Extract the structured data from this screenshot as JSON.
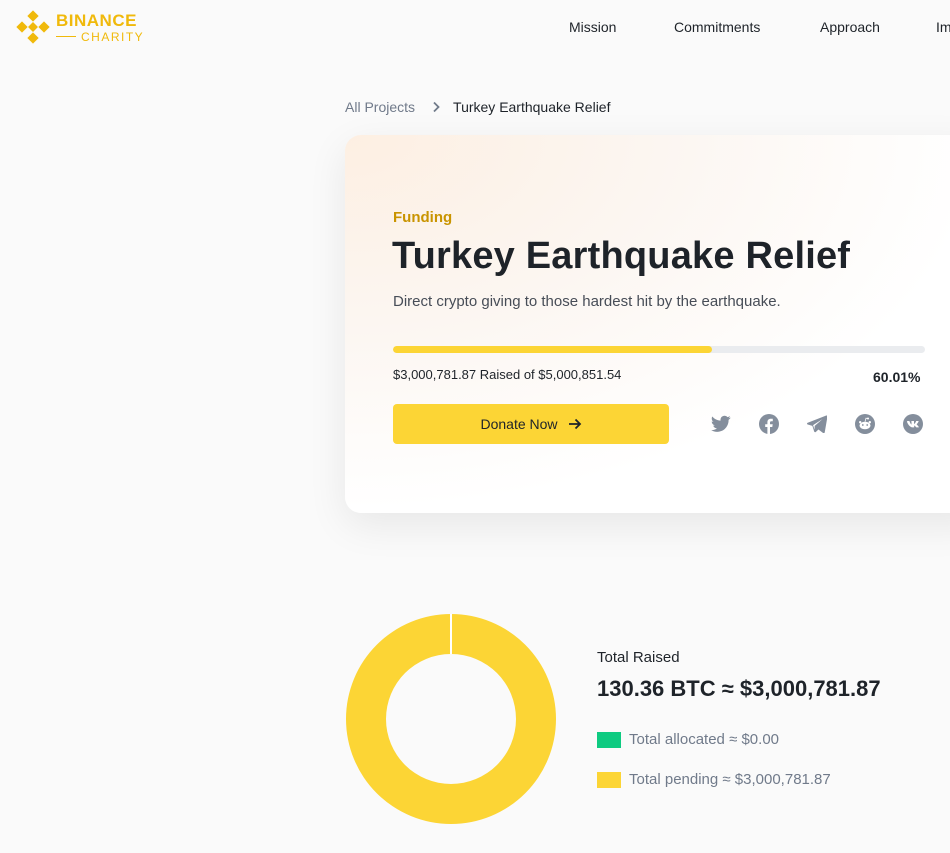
{
  "brand": {
    "name": "BINANCE",
    "sub": "CHARITY",
    "color": "#f0b90b"
  },
  "nav": {
    "items": [
      "Mission",
      "Commitments",
      "Approach",
      "Impact"
    ]
  },
  "breadcrumb": {
    "parent": "All Projects",
    "current": "Turkey Earthquake Relief"
  },
  "project": {
    "status": "Funding",
    "title": "Turkey Earthquake Relief",
    "description": "Direct crypto giving to those hardest hit by the earthquake.",
    "raised_text": "$3,000,781.87 Raised of $5,000,851.54",
    "percent_text": "60.01%",
    "progress_fraction": 0.6001,
    "donate_label": "Donate Now",
    "share_icons": [
      "twitter-icon",
      "facebook-icon",
      "telegram-icon",
      "reddit-icon",
      "vk-icon"
    ]
  },
  "totals": {
    "label": "Total Raised",
    "value": "130.36 BTC ≈ $3,000,781.87",
    "allocated_label": "Total allocated ≈ $0.00",
    "pending_label": "Total pending ≈ $3,000,781.87",
    "allocated_color": "#0ecb81",
    "pending_color": "#fcd535",
    "allocated_fraction": 0,
    "pending_fraction": 1
  }
}
